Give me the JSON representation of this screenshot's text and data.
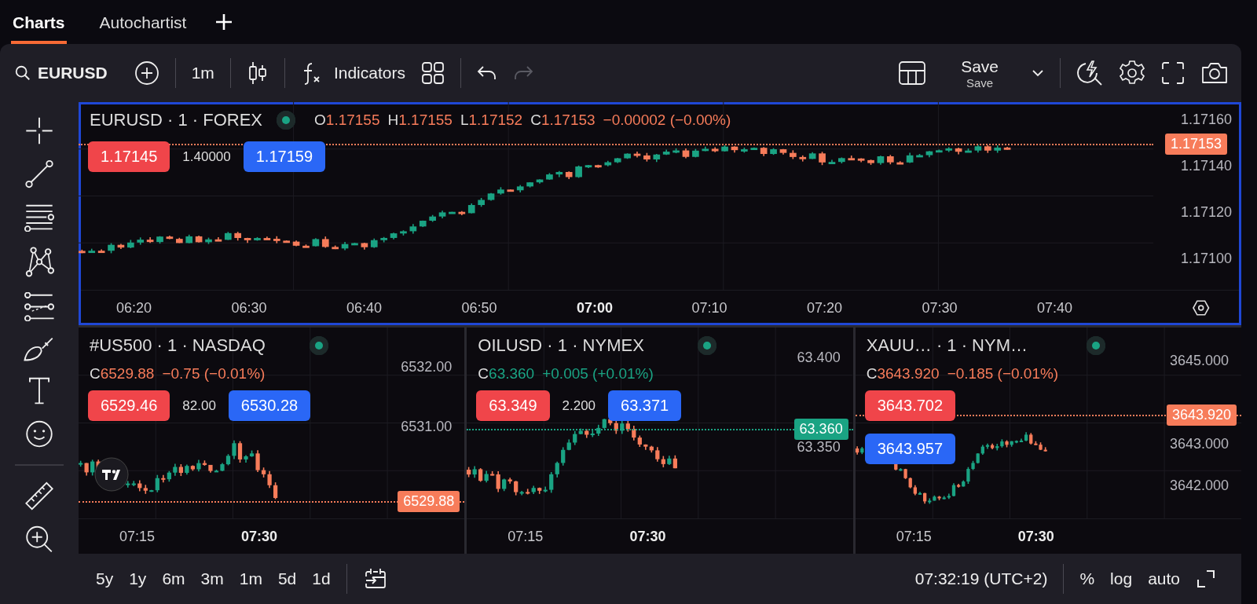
{
  "tabs": [
    {
      "label": "Charts",
      "selected": true
    },
    {
      "label": "Autochartist",
      "selected": false
    }
  ],
  "toolbar": {
    "symbol": "EURUSD",
    "interval": "1m",
    "indicators": "Indicators",
    "save": "Save",
    "save_caption": "Save",
    "undo_disabled": false,
    "redo_disabled": true
  },
  "charts": [
    {
      "title": "EURUSD · 1 · FOREX",
      "selected": true,
      "rising": false,
      "stacked_quotes": false,
      "ohlc": [
        {
          "label": "O",
          "value": "1.17155"
        },
        {
          "label": "H",
          "value": "1.17155"
        },
        {
          "label": "L",
          "value": "1.17152"
        },
        {
          "label": "C",
          "value": "1.17153"
        }
      ],
      "change": "−0.00002 (−0.00%)",
      "bid": "1.17145",
      "spread": "1.40000",
      "ask": "1.17159",
      "price_ticks": [
        "1.17160",
        "1.17140",
        "1.17120",
        "1.17100"
      ],
      "last_price": "1.17153",
      "time_ticks": [
        {
          "label": "06:20",
          "bold": false
        },
        {
          "label": "06:30",
          "bold": false
        },
        {
          "label": "06:40",
          "bold": false
        },
        {
          "label": "06:50",
          "bold": false
        },
        {
          "label": "07:00",
          "bold": true
        },
        {
          "label": "07:10",
          "bold": false
        },
        {
          "label": "07:20",
          "bold": false
        },
        {
          "label": "07:30",
          "bold": false
        },
        {
          "label": "07:40",
          "bold": false
        }
      ]
    },
    {
      "title": "#US500 · 1 · NASDAQ",
      "selected": false,
      "rising": false,
      "stacked_quotes": false,
      "ohlc": [
        {
          "label": "C",
          "value": "6529.88"
        }
      ],
      "change": "−0.75 (−0.01%)",
      "bid": "6529.46",
      "spread": "82.00",
      "ask": "6530.28",
      "price_ticks": [
        "6532.00",
        "6531.00"
      ],
      "last_price": "6529.88",
      "time_ticks": [
        {
          "label": "07:15",
          "bold": false
        },
        {
          "label": "07:30",
          "bold": true
        }
      ]
    },
    {
      "title": "OILUSD · 1 · NYMEX",
      "selected": false,
      "rising": true,
      "stacked_quotes": false,
      "ohlc": [
        {
          "label": "C",
          "value": "63.360"
        }
      ],
      "change": "+0.005 (+0.01%)",
      "bid": "63.349",
      "spread": "2.200",
      "ask": "63.371",
      "price_ticks": [
        "63.400",
        "63.350"
      ],
      "last_price": "63.360",
      "time_ticks": [
        {
          "label": "07:15",
          "bold": false
        },
        {
          "label": "07:30",
          "bold": true
        }
      ]
    },
    {
      "title": "XAUU…   · 1 · NYM…",
      "selected": false,
      "rising": false,
      "stacked_quotes": true,
      "ohlc": [
        {
          "label": "C",
          "value": "3643.920"
        }
      ],
      "change": "−0.185 (−0.01%)",
      "bid": "3643.702",
      "ask": "3643.957",
      "price_ticks": [
        "3645.000",
        "3643.000",
        "3642.000"
      ],
      "last_price": "3643.920",
      "time_ticks": [
        {
          "label": "07:15",
          "bold": false
        },
        {
          "label": "07:30",
          "bold": true
        }
      ]
    }
  ],
  "bottom_bar": {
    "ranges": [
      "5y",
      "1y",
      "6m",
      "3m",
      "1m",
      "5d",
      "1d"
    ],
    "clock": "07:32:19 (UTC+2)",
    "percent": "%",
    "log": "log",
    "auto": "auto"
  }
}
